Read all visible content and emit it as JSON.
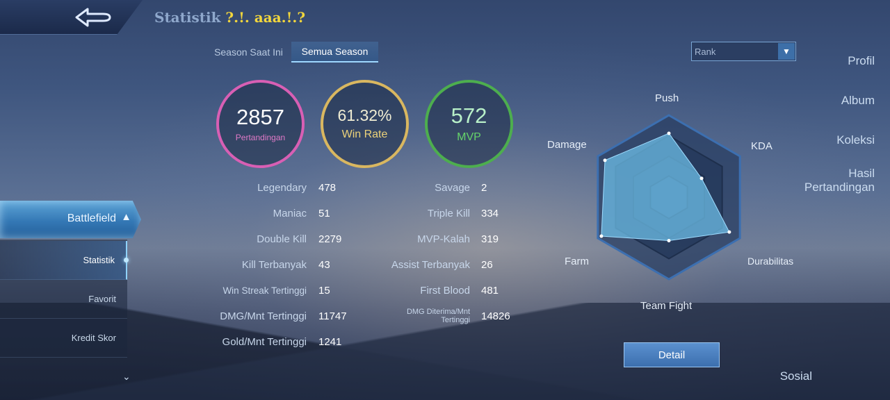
{
  "header": {
    "title": "Statistik",
    "player_name": "?.!. aaa.!.?"
  },
  "sidebar": {
    "items": [
      {
        "label": "Profil"
      },
      {
        "label": "Album"
      },
      {
        "label": "Koleksi"
      },
      {
        "label": "Hasil Pertandingan"
      },
      {
        "label": "Battlefield"
      },
      {
        "label": "Sosial"
      }
    ],
    "sub_items": [
      {
        "label": "Statistik"
      },
      {
        "label": "Favorit"
      },
      {
        "label": "Kredit Skor"
      }
    ]
  },
  "tabs": [
    {
      "label": "Season Saat Ini"
    },
    {
      "label": "Semua Season"
    }
  ],
  "summary": {
    "matches": {
      "value": "2857",
      "label": "Pertandingan"
    },
    "win_rate": {
      "value": "61.32%",
      "label": "Win Rate"
    },
    "mvp": {
      "value": "572",
      "label": "MVP"
    }
  },
  "stats_left": [
    {
      "label": "Legendary",
      "value": "478"
    },
    {
      "label": "Maniac",
      "value": "51"
    },
    {
      "label": "Double Kill",
      "value": "2279"
    },
    {
      "label": "Kill Terbanyak",
      "value": "43"
    },
    {
      "label": "Win Streak Tertinggi",
      "value": "15"
    },
    {
      "label": "DMG/Mnt Tertinggi",
      "value": "11747"
    },
    {
      "label": "Gold/Mnt Tertinggi",
      "value": "1241"
    }
  ],
  "stats_right": [
    {
      "label": "Savage",
      "value": "2"
    },
    {
      "label": "Triple Kill",
      "value": "334"
    },
    {
      "label": "MVP-Kalah",
      "value": "319"
    },
    {
      "label": "Assist Terbanyak",
      "value": "26"
    },
    {
      "label": "First Blood",
      "value": "481"
    },
    {
      "label": "DMG Diterima/Mnt Tertinggi",
      "value": "14826"
    }
  ],
  "rank_select": {
    "value": "Rank"
  },
  "radar": {
    "labels": [
      "Push",
      "KDA",
      "Durabilitas",
      "Team Fight",
      "Farm",
      "Damage"
    ],
    "values": [
      0.78,
      0.46,
      0.85,
      0.53,
      0.95,
      0.9
    ]
  },
  "detail_button": {
    "label": "Detail"
  },
  "colors": {
    "matches_ring": "#d85fb4",
    "winrate_ring": "#d9b760",
    "mvp_ring": "#4dae4e",
    "title_name": "#f2d63c",
    "radar_fill": "#6fc2ec"
  },
  "icons": {
    "back": "back-arrow-icon",
    "chevron_up": "chevron-up-icon",
    "chevron_down": "chevron-down-icon"
  }
}
